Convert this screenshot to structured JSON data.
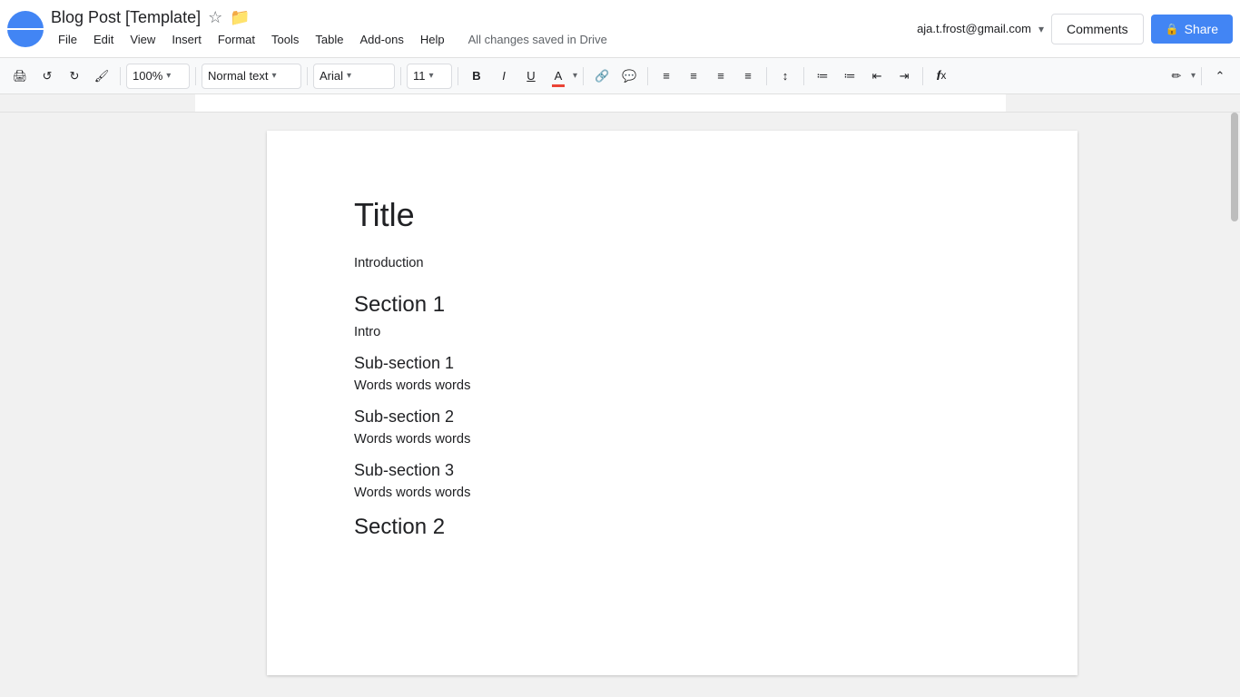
{
  "topbar": {
    "doc_title": "Blog Post [Template]",
    "star_icon": "☆",
    "folder_icon": "📁",
    "user_email": "aja.t.frost@gmail.com",
    "save_status": "All changes saved in Drive",
    "comments_label": "Comments",
    "share_label": "Share"
  },
  "menu": {
    "items": [
      "File",
      "Edit",
      "View",
      "Insert",
      "Format",
      "Tools",
      "Table",
      "Add-ons",
      "Help"
    ]
  },
  "toolbar": {
    "zoom": "100%",
    "style": "Normal text",
    "font": "Arial",
    "size": "11",
    "bold": "B",
    "italic": "I",
    "underline": "U"
  },
  "document": {
    "title": "Title",
    "introduction": "Introduction",
    "section1": {
      "heading": "Section 1",
      "intro": "Intro",
      "subsection1": {
        "heading": "Sub-section 1",
        "body": "Words words words"
      },
      "subsection2": {
        "heading": "Sub-section 2",
        "body": "Words words words"
      },
      "subsection3": {
        "heading": "Sub-section 3",
        "body": "Words words words"
      }
    },
    "section2": {
      "heading": "Section 2"
    }
  }
}
